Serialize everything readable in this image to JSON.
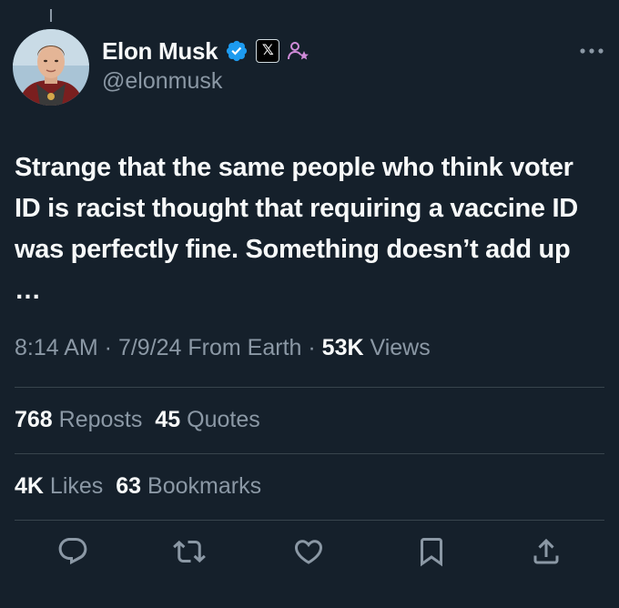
{
  "author": {
    "display_name": "Elon Musk",
    "handle": "@elonmusk",
    "verified_icon": "verified-badge-icon",
    "affiliation_icon": "x-logo-icon",
    "extra_badge_icon": "person-star-icon"
  },
  "tweet": {
    "text": "Strange that the same people who think voter ID is racist thought that requiring a vaccine ID was perfectly fine. Something doesn’t add up …"
  },
  "meta": {
    "time": "8:14 AM",
    "sep1": " · ",
    "date": "7/9/24",
    "location": " From Earth",
    "sep2": " · ",
    "views_count": "53K",
    "views_label": " Views"
  },
  "stats": {
    "reposts_count": "768",
    "reposts_label": " Reposts",
    "quotes_count": "45",
    "quotes_label": " Quotes",
    "likes_count": "4K",
    "likes_label": " Likes",
    "bookmarks_count": "63",
    "bookmarks_label": " Bookmarks"
  },
  "actions": [
    "reply-icon",
    "repost-icon",
    "like-icon",
    "bookmark-icon",
    "share-icon"
  ],
  "colors": {
    "background": "#15202b",
    "text": "#f7f9f9",
    "secondary": "#8b98a5",
    "verified": "#1d9bf0",
    "divider": "#38444d"
  }
}
